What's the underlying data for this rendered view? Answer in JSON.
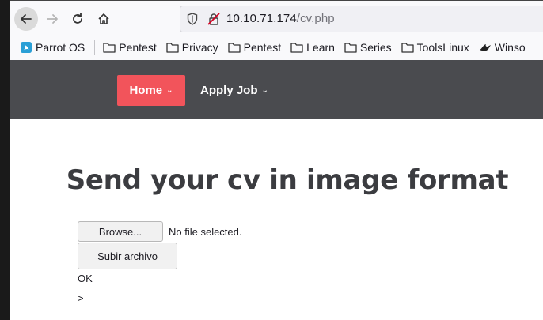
{
  "browser": {
    "url_host": "10.10.71.174",
    "url_path": "/cv.php"
  },
  "bookmarks": [
    {
      "label": "Parrot OS",
      "icon": "parrot-icon"
    },
    {
      "label": "Pentest",
      "icon": "folder-icon"
    },
    {
      "label": "Privacy",
      "icon": "folder-icon"
    },
    {
      "label": "Pentest",
      "icon": "folder-icon"
    },
    {
      "label": "Learn",
      "icon": "folder-icon"
    },
    {
      "label": "Series",
      "icon": "folder-icon"
    },
    {
      "label": "ToolsLinux",
      "icon": "folder-icon"
    },
    {
      "label": "Winso",
      "icon": "bird-icon"
    }
  ],
  "site_nav": {
    "home_label": "Home",
    "apply_label": "Apply Job"
  },
  "page": {
    "title": "Send your cv in image format",
    "browse_label": "Browse...",
    "no_file_text": "No file selected.",
    "submit_label": "Subir archivo",
    "status_text": "OK",
    "trailing_text": ">"
  },
  "colors": {
    "nav_bg": "#4a4b4f",
    "home_button_bg": "#f2545b",
    "title_color": "#3b3c40"
  }
}
